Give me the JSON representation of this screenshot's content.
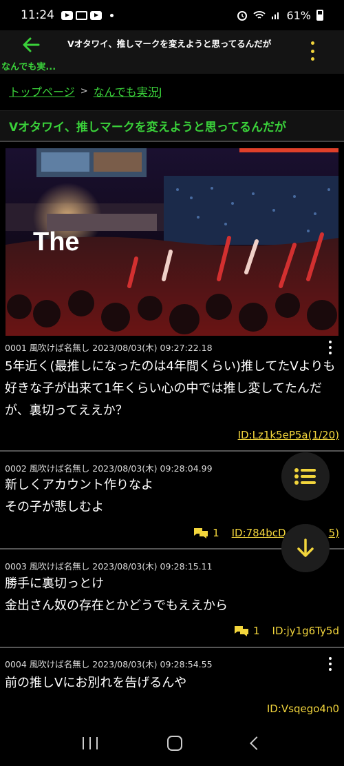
{
  "status_bar": {
    "time": "11:24",
    "battery": "61%"
  },
  "app_bar": {
    "back_title": "なんでも実...",
    "title": "Vオタワイ、推しマークを変えようと思ってるんだが"
  },
  "breadcrumb": {
    "home": "トップページ",
    "separator": ">",
    "board": "なんでも実況J"
  },
  "thread": {
    "title": "Vオタワイ、推しマークを変えようと思ってるんだが"
  },
  "hero": {
    "overlay_text": "The"
  },
  "posts": [
    {
      "meta": "0001 風吹けば名無し 2023/08/03(木) 09:27:22.18",
      "body": "5年近く(最推しになったのは4年間くらい)推してたVよりも好きな子が出来て1年くらい心の中では推し変してたんだが、裏切ってええか？",
      "replies": "",
      "id": "ID:Lz1k5eP5a(1/20)"
    },
    {
      "meta": "0002 風吹けば名無し 2023/08/03(木) 09:28:04.99",
      "body": "新しくアカウント作りなよ\nその子が悲しむよ",
      "replies": "1",
      "id": "ID:784bcD",
      "id_tail": "5)"
    },
    {
      "meta": "0003 風吹けば名無し 2023/08/03(木) 09:28:15.11",
      "body": "勝手に裏切っとけ\n金出さん奴の存在とかどうでもええから",
      "replies": "1",
      "id": "ID:jy1g6Ty5d"
    },
    {
      "meta": "0004 風吹けば名無し 2023/08/03(木) 09:28:54.55",
      "body": "前の推しVにお別れを告げるんや",
      "replies": "",
      "id": "ID:Vsqego4n0"
    }
  ],
  "colors": {
    "accent_green": "#3ad13a",
    "accent_yellow": "#f2d53c",
    "background": "#000000"
  },
  "icons": {
    "back": "arrow-left-icon",
    "menu": "more-vert-icon",
    "list": "list-icon",
    "scroll": "arrow-down-icon",
    "reply": "chat-bubbles-icon"
  }
}
